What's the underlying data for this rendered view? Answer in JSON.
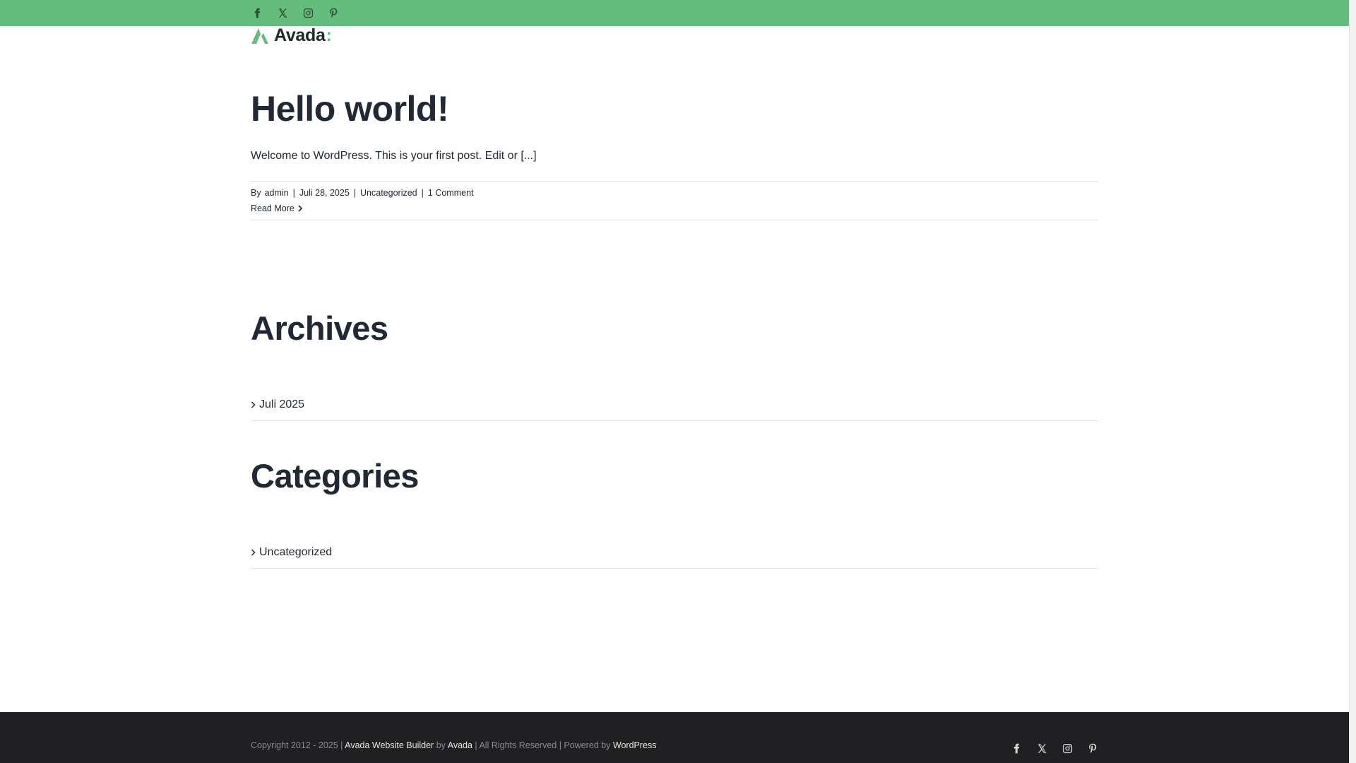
{
  "top_social": {
    "facebook": "facebook-icon",
    "x": "x-icon",
    "instagram": "instagram-icon",
    "pinterest": "pinterest-icon"
  },
  "logo": {
    "text": "Avada",
    "colon": ":",
    "accent_color": "#65bd7d"
  },
  "post": {
    "title": "Hello world!",
    "excerpt": "Welcome to WordPress. This is your first post. Edit or [...]",
    "meta": {
      "by_label": "By",
      "author": "admin",
      "separator": "|",
      "date": "Juli 28, 2025",
      "category": "Uncategorized",
      "comments": "1 Comment"
    },
    "read_more": "Read More"
  },
  "archives": {
    "title": "Archives",
    "items": [
      "Juli 2025"
    ]
  },
  "categories": {
    "title": "Categories",
    "items": [
      "Uncategorized"
    ]
  },
  "footer": {
    "copyright_prefix": "Copyright 2012 - 2025 |",
    "builder_link": "Avada Website Builder",
    "by": "by",
    "avada_link": "Avada",
    "rights": "| All Rights Reserved | Powered by",
    "wordpress_link": "WordPress",
    "background_color": "#202022"
  },
  "colors": {
    "topbar": "#65bd7d",
    "text": "#212934",
    "divider": "#e2e2e2"
  }
}
